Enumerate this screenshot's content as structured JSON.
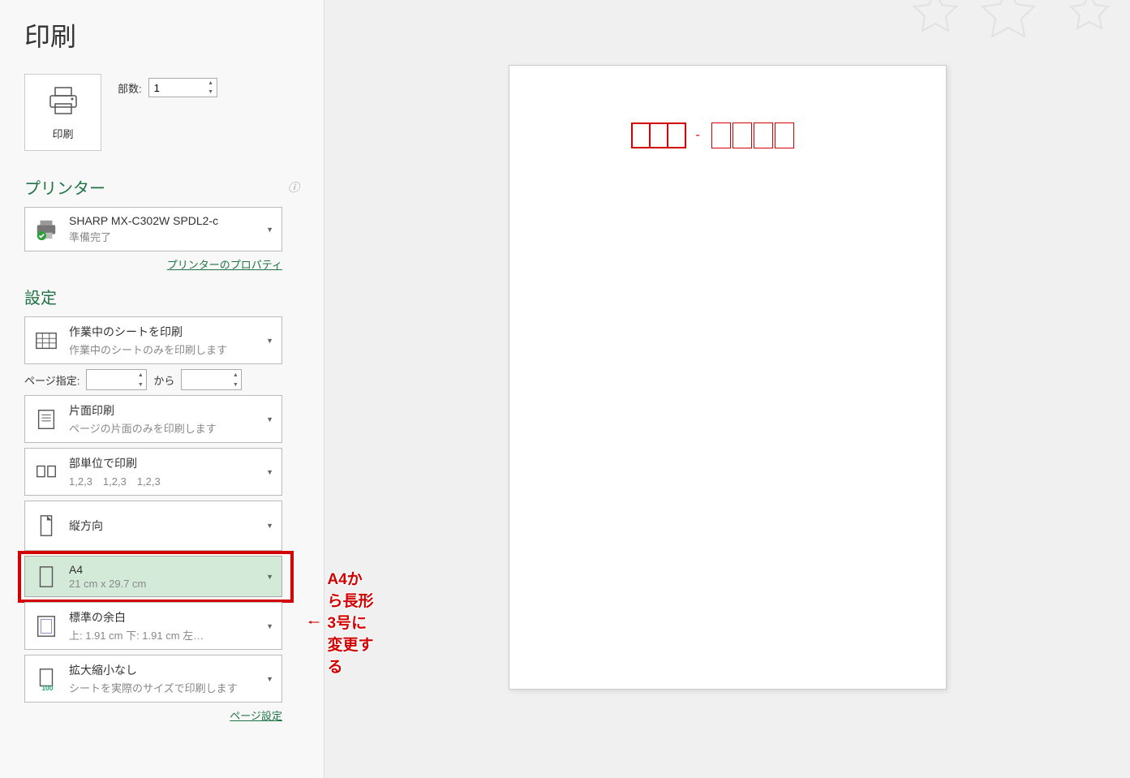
{
  "title": "印刷",
  "print_button_label": "印刷",
  "copies": {
    "label": "部数:",
    "value": "1"
  },
  "printer_section": {
    "header": "プリンター",
    "name": "SHARP MX-C302W SPDL2-c",
    "status": "準備完了",
    "properties_link": "プリンターのプロパティ"
  },
  "settings_section": {
    "header": "設定",
    "print_what": {
      "title": "作業中のシートを印刷",
      "sub": "作業中のシートのみを印刷します"
    },
    "page_spec": {
      "label": "ページ指定:",
      "from": "",
      "to_label": "から",
      "to": ""
    },
    "sides": {
      "title": "片面印刷",
      "sub": "ページの片面のみを印刷します"
    },
    "collate": {
      "title": "部単位で印刷",
      "sub": "1,2,3　1,2,3　1,2,3"
    },
    "orientation": {
      "title": "縦方向"
    },
    "paper": {
      "title": "A4",
      "sub": "21 cm x 29.7 cm"
    },
    "margins": {
      "title": "標準の余白",
      "sub": "上: 1.91 cm 下: 1.91 cm 左…"
    },
    "scaling": {
      "title": "拡大縮小なし",
      "sub": "シートを実際のサイズで印刷します"
    },
    "page_setup_link": "ページ設定"
  },
  "annotation_text": "A4から長形3号に変更する"
}
